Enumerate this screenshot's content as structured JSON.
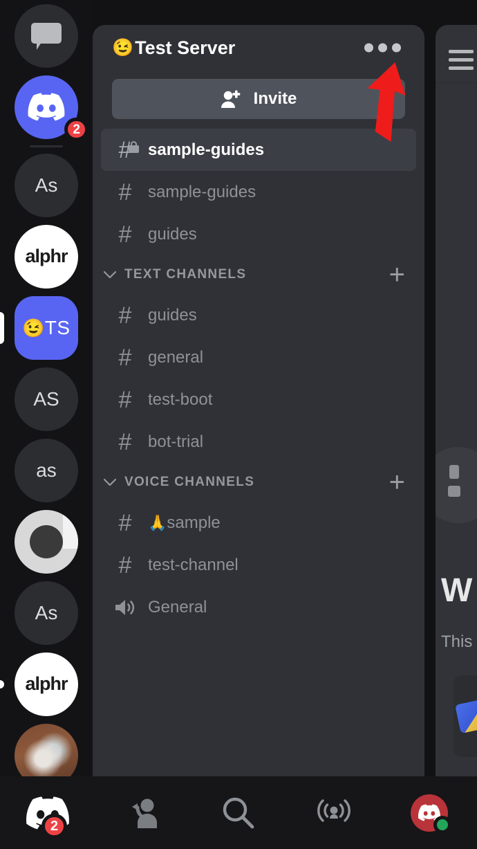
{
  "app": {
    "name": "Discord",
    "platform": "mobile"
  },
  "colors": {
    "rail_bg": "#131316",
    "panel_bg": "#2f3136",
    "content_bg": "#313338",
    "nav_bg": "#161618",
    "blurple": "#5865f2",
    "badge_red": "#ed4245",
    "online_green": "#23a55a",
    "active_row": "#3b3e45",
    "invite_button": "#4f545c",
    "muted_text": "#8e9297",
    "category_text": "#96989d",
    "annotation_arrow": "#ef1c1c"
  },
  "server_rail": {
    "items": [
      {
        "name": "direct-messages",
        "type": "dm-button",
        "icon": "speech-bubble-icon",
        "label": "",
        "selected": false,
        "badge": ""
      },
      {
        "name": "discord-server",
        "type": "logo",
        "icon": "discord-logo-icon",
        "label": "",
        "selected": false,
        "badge": "2"
      },
      {
        "name": "server-as-1",
        "type": "initials",
        "icon": "",
        "label": "As",
        "selected": false,
        "badge": ""
      },
      {
        "name": "server-alphr-1",
        "type": "wordmark",
        "icon": "",
        "label": "alphr",
        "selected": false,
        "badge": ""
      },
      {
        "name": "server-test-server",
        "type": "initials-emoji",
        "icon": "",
        "label": "TS",
        "emoji": "😉",
        "selected": true,
        "badge": ""
      },
      {
        "name": "server-as-uppercase",
        "type": "initials",
        "icon": "",
        "label": "AS",
        "selected": false,
        "badge": ""
      },
      {
        "name": "server-as-lowercase",
        "type": "initials",
        "icon": "",
        "label": "as",
        "selected": false,
        "badge": ""
      },
      {
        "name": "server-ring-logo",
        "type": "ring-logo",
        "icon": "",
        "label": "",
        "selected": false,
        "badge": ""
      },
      {
        "name": "server-as-2",
        "type": "initials",
        "icon": "",
        "label": "As",
        "selected": false,
        "badge": ""
      },
      {
        "name": "server-alphr-2",
        "type": "wordmark",
        "icon": "",
        "label": "alphr",
        "selected": false,
        "badge": "",
        "indicator": "dot"
      },
      {
        "name": "server-photo",
        "type": "photo",
        "icon": "",
        "label": "",
        "selected": false,
        "badge": ""
      }
    ]
  },
  "channel_panel": {
    "server_emoji": "😉",
    "server_name": "Test Server",
    "more_menu_label": "•••",
    "invite": {
      "label": "Invite",
      "icon": "person-add-icon"
    },
    "top_channels": [
      {
        "name": "sample-guides",
        "icon": "hash-lock-icon",
        "active": true,
        "emoji": ""
      },
      {
        "name": "sample-guides",
        "icon": "hash-icon",
        "active": false,
        "emoji": ""
      },
      {
        "name": "guides",
        "icon": "hash-icon",
        "active": false,
        "emoji": ""
      }
    ],
    "categories": [
      {
        "label": "TEXT CHANNELS",
        "collapse_icon": "chevron-down-icon",
        "add_icon": "plus-icon",
        "channels": [
          {
            "name": "guides",
            "icon": "hash-icon",
            "active": false,
            "emoji": ""
          },
          {
            "name": "general",
            "icon": "hash-icon",
            "active": false,
            "emoji": ""
          },
          {
            "name": "test-boot",
            "icon": "hash-icon",
            "active": false,
            "emoji": ""
          },
          {
            "name": "bot-trial",
            "icon": "hash-icon",
            "active": false,
            "emoji": ""
          }
        ]
      },
      {
        "label": "VOICE CHANNELS",
        "collapse_icon": "chevron-down-icon",
        "add_icon": "plus-icon",
        "channels": [
          {
            "name": "sample",
            "icon": "hash-icon",
            "active": false,
            "emoji": "🙏"
          },
          {
            "name": "test-channel",
            "icon": "hash-icon",
            "active": false,
            "emoji": ""
          },
          {
            "name": "General",
            "icon": "speaker-icon",
            "active": false,
            "emoji": ""
          }
        ]
      }
    ]
  },
  "right_panel": {
    "menu_icon": "hamburger-icon",
    "welcome_title": "W",
    "welcome_subtitle": "This"
  },
  "bottom_nav": {
    "items": [
      {
        "name": "nav-home",
        "icon": "discord-logo-icon",
        "badge": "2"
      },
      {
        "name": "nav-friends",
        "icon": "friends-icon",
        "badge": ""
      },
      {
        "name": "nav-search",
        "icon": "search-icon",
        "badge": ""
      },
      {
        "name": "nav-mentions",
        "icon": "broadcast-icon",
        "badge": ""
      },
      {
        "name": "nav-profile",
        "icon": "user-avatar-icon",
        "badge": "",
        "status": "online"
      }
    ]
  },
  "annotation": {
    "type": "arrow",
    "points_to": "more-menu-button",
    "color": "#ef1c1c"
  }
}
